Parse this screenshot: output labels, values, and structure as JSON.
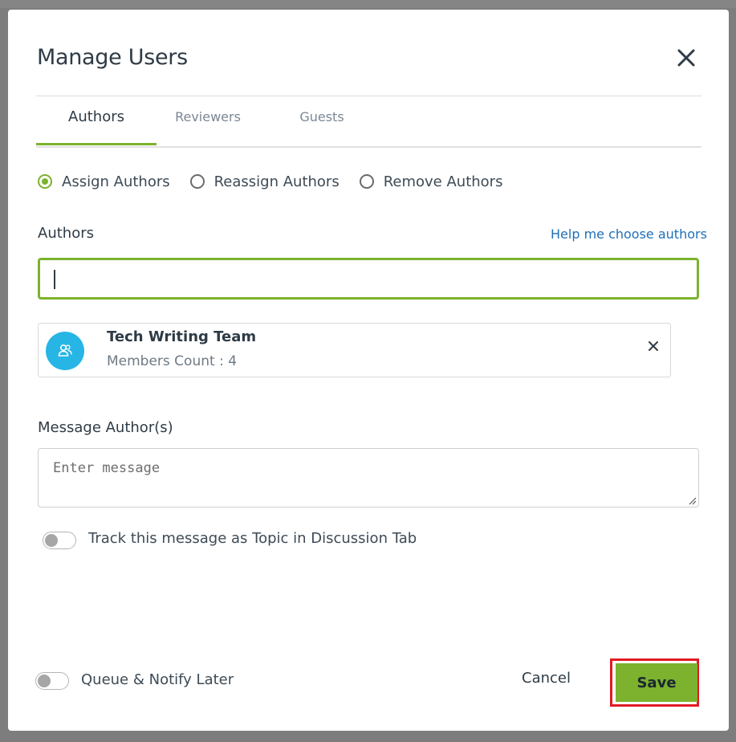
{
  "modal": {
    "title": "Manage Users",
    "tabs": [
      {
        "label": "Authors",
        "active": true
      },
      {
        "label": "Reviewers",
        "active": false
      },
      {
        "label": "Guests",
        "active": false
      }
    ],
    "assignment_options": [
      {
        "label": "Assign Authors",
        "checked": true
      },
      {
        "label": "Reassign Authors",
        "checked": false
      },
      {
        "label": "Remove Authors",
        "checked": false
      }
    ],
    "authors": {
      "label": "Authors",
      "help_link": "Help me choose authors",
      "input_value": "",
      "selected": [
        {
          "name": "Tech Writing Team",
          "members": "Members Count : 4"
        }
      ]
    },
    "message": {
      "label": "Message Author(s)",
      "placeholder": "Enter message",
      "track_toggle_label": "Track this message as Topic in Discussion Tab",
      "track_toggle_on": false
    },
    "footer": {
      "queue_toggle_label": "Queue & Notify Later",
      "queue_toggle_on": false,
      "cancel_label": "Cancel",
      "save_label": "Save"
    }
  },
  "colors": {
    "accent": "#7cb22d",
    "link": "#1f6fb8",
    "avatar": "#27b5e6",
    "highlight": "#e01b24"
  }
}
